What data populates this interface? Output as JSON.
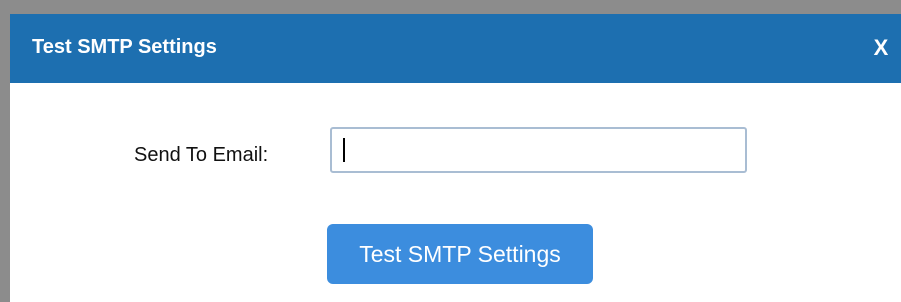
{
  "dialog": {
    "title": "Test SMTP Settings",
    "close_label": "X",
    "title_bar_color": "#1d6fb0"
  },
  "form": {
    "email_label": "Send To Email:",
    "email_value": "",
    "email_placeholder": ""
  },
  "actions": {
    "test_button_label": "Test SMTP Settings",
    "test_button_color": "#3c8dde"
  }
}
